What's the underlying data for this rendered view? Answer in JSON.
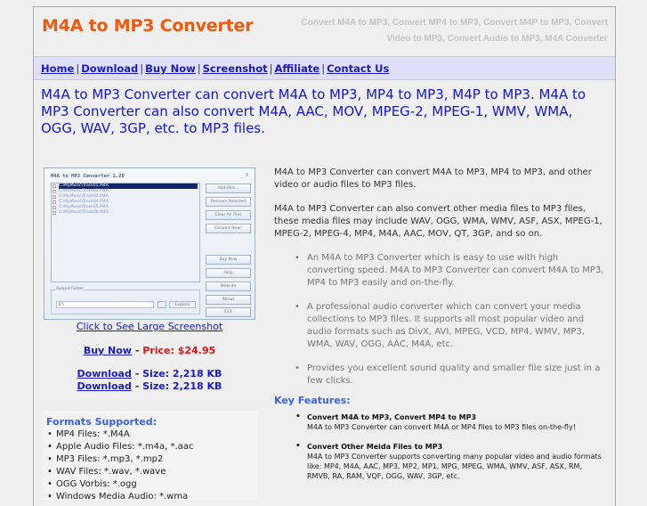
{
  "header": {
    "logo": "M4A to MP3 Converter",
    "tagline": "Convert M4A to MP3, Convert MP4 to MP3, Convert M4P to MP3, Convert Video to MP3, Convert Audio to MP3, M4A Converter"
  },
  "nav": {
    "items": [
      "Home",
      "Download",
      "Buy Now",
      "Screenshot",
      "Affiliate",
      "Contact Us"
    ],
    "separator": "|"
  },
  "intro": "M4A to MP3 Converter can convert M4A to MP3, MP4 to MP3, M4P to MP3. M4A to MP3 Converter can also convert M4A, AAC, MOV, MPEG-2, MPEG-1, WMV, WMA, OGG, WAV, 3GP, etc. to MP3 files.",
  "screenshot": {
    "window_title": "M4A to MP3 Converter 1.20",
    "window_controls": "_ ×",
    "files": [
      "C:\\MyMusic\\Track01.M4A",
      "C:\\MyMusic\\Track02.M4A",
      "C:\\MyMusic\\Track03.M4A",
      "C:\\MyMusic\\Track04.M4A",
      "C:\\MyMusic\\Track05.M4A",
      "C:\\MyMusic\\Track06.M4A"
    ],
    "buttons": [
      "Add Files...",
      "Remove Selected",
      "Clear All Files",
      "Convert Now!",
      "Buy Now",
      "Help",
      "Website",
      "About",
      "Exit"
    ],
    "output_folder_label": "Output Folder",
    "output_folder_value": "E:\\",
    "browse_label": "...",
    "explore_label": "Explore",
    "caption": "Click to See Large Screenshot"
  },
  "purchase": {
    "buy_label": "Buy Now",
    "dash": "-",
    "price": "Price: $24.95",
    "downloads": [
      {
        "label": "Download",
        "size": "Size: 2,218 KB"
      },
      {
        "label": "Download",
        "size": "Size: 2,218 KB"
      }
    ]
  },
  "formats": {
    "title": "Formats Supported:",
    "items": [
      "MP4 Files: *.M4A",
      "Apple Audio Files: *.m4a, *.aac",
      "MP3 Files: *.mp3, *.mp2",
      "WAV Files: *.wav, *.wave",
      "OGG Vorbis: *.ogg",
      "Windows Media Audio: *.wma"
    ]
  },
  "description": {
    "para1": "M4A to MP3 Converter can convert M4A to MP3, MP4 to MP3, and other video or audio files to MP3 files.",
    "para2": "M4A to MP3 Converter can also convert other media files to MP3 files, these media files may include WAV, OGG, WMA, WMV, ASF, ASX, MPEG-1, MPEG-2, MPEG-4, MP4, M4A, AAC, MOV, QT, 3GP, and so on.",
    "bullets": [
      "An M4A to MP3 Converter which is easy to use with high converting speed. M4A to MP3 Converter can convert M4A to MP3, MP4 to MP3 easily and on-the-fly.",
      "A professional audio converter which can convert your media collections to MP3 files. It supports all most popular video and audio formats such as DivX, AVI, MPEG, VCD, MP4, WMV, MP3, WMA, WAV, OGG, AAC, M4A, etc.",
      "Provides you excellent sound quality and smaller file size just in a few clicks."
    ]
  },
  "key_features": {
    "title": "Key Features:",
    "items": [
      {
        "title": "Convert M4A to MP3, Convert MP4 to MP3",
        "text": "M4A to MP3 Converter can convert M4A or MP4 files to MP3 files on-the-fly!"
      },
      {
        "title": "Convert Other Meida Files to MP3",
        "text": "M4A to MP3 Converter supports converting many popular video and audio formats like: MP4, M4A, AAC, MP3, MP2, MP1, MPG, MPEG, WMA, WMV, ASF, ASX, RM, RMVB, RA, RAM, VQF, OGG, WAV, 3GP, etc."
      }
    ]
  }
}
